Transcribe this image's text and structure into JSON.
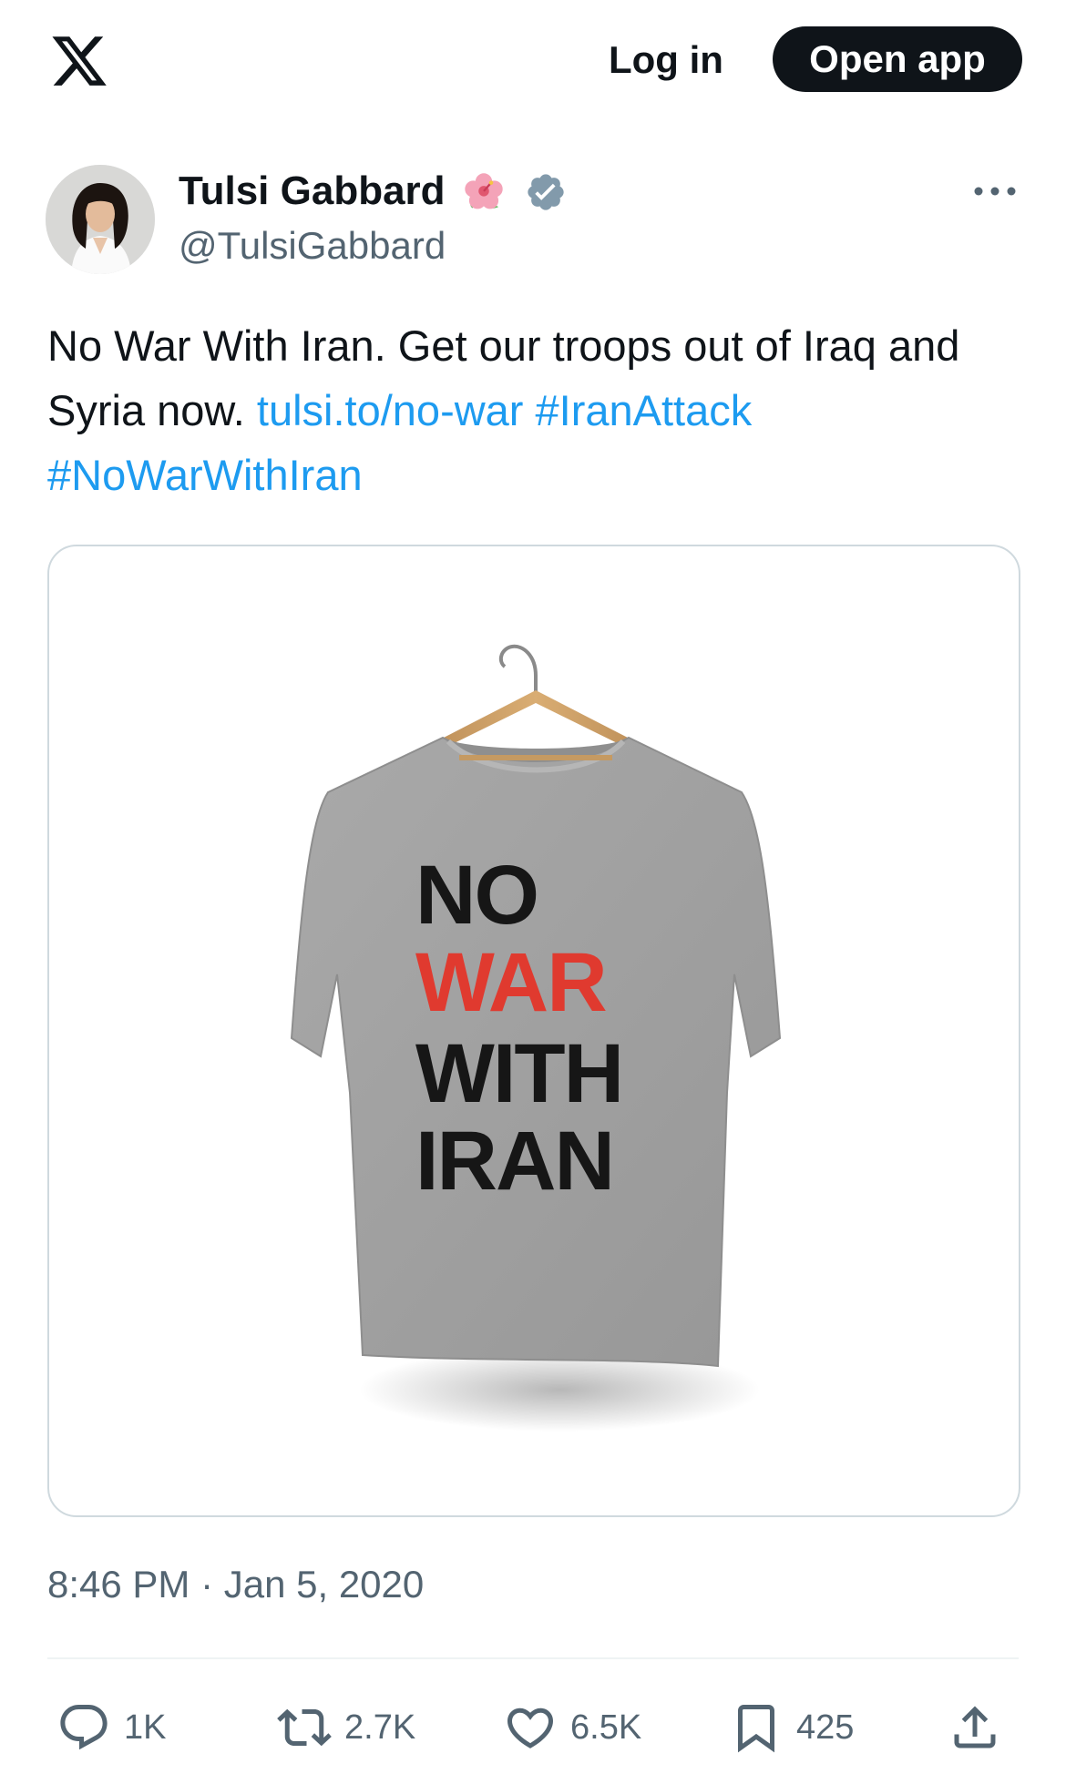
{
  "topbar": {
    "login_label": "Log in",
    "open_app_label": "Open app",
    "logo_icon": "x-logo-icon"
  },
  "author": {
    "name": "Tulsi Gabbard",
    "handle": "@TulsiGabbard",
    "name_emoji_icon": "hibiscus-flower-icon",
    "verified_icon": "verified-badge-icon"
  },
  "tweet": {
    "text_plain": "No War With Iran. Get our troops out of Iraq and Syria now. ",
    "link": "tulsi.to/no-war",
    "hashtag1": "#IranAttack",
    "hashtag2": "#NoWarWithIran",
    "timestamp": "8:46 PM · Jan 5, 2020"
  },
  "shirt": {
    "line1": "NO",
    "line2": "WAR",
    "line3": "WITH",
    "line4": "IRAN"
  },
  "actions": {
    "replies": "1K",
    "retweets": "2.7K",
    "likes": "6.5K",
    "bookmarks": "425"
  },
  "colors": {
    "link": "#1d9bf0",
    "text": "#0f1419",
    "secondary": "#536471",
    "verified": "#829aab",
    "shirt_red": "#e03a2f"
  }
}
